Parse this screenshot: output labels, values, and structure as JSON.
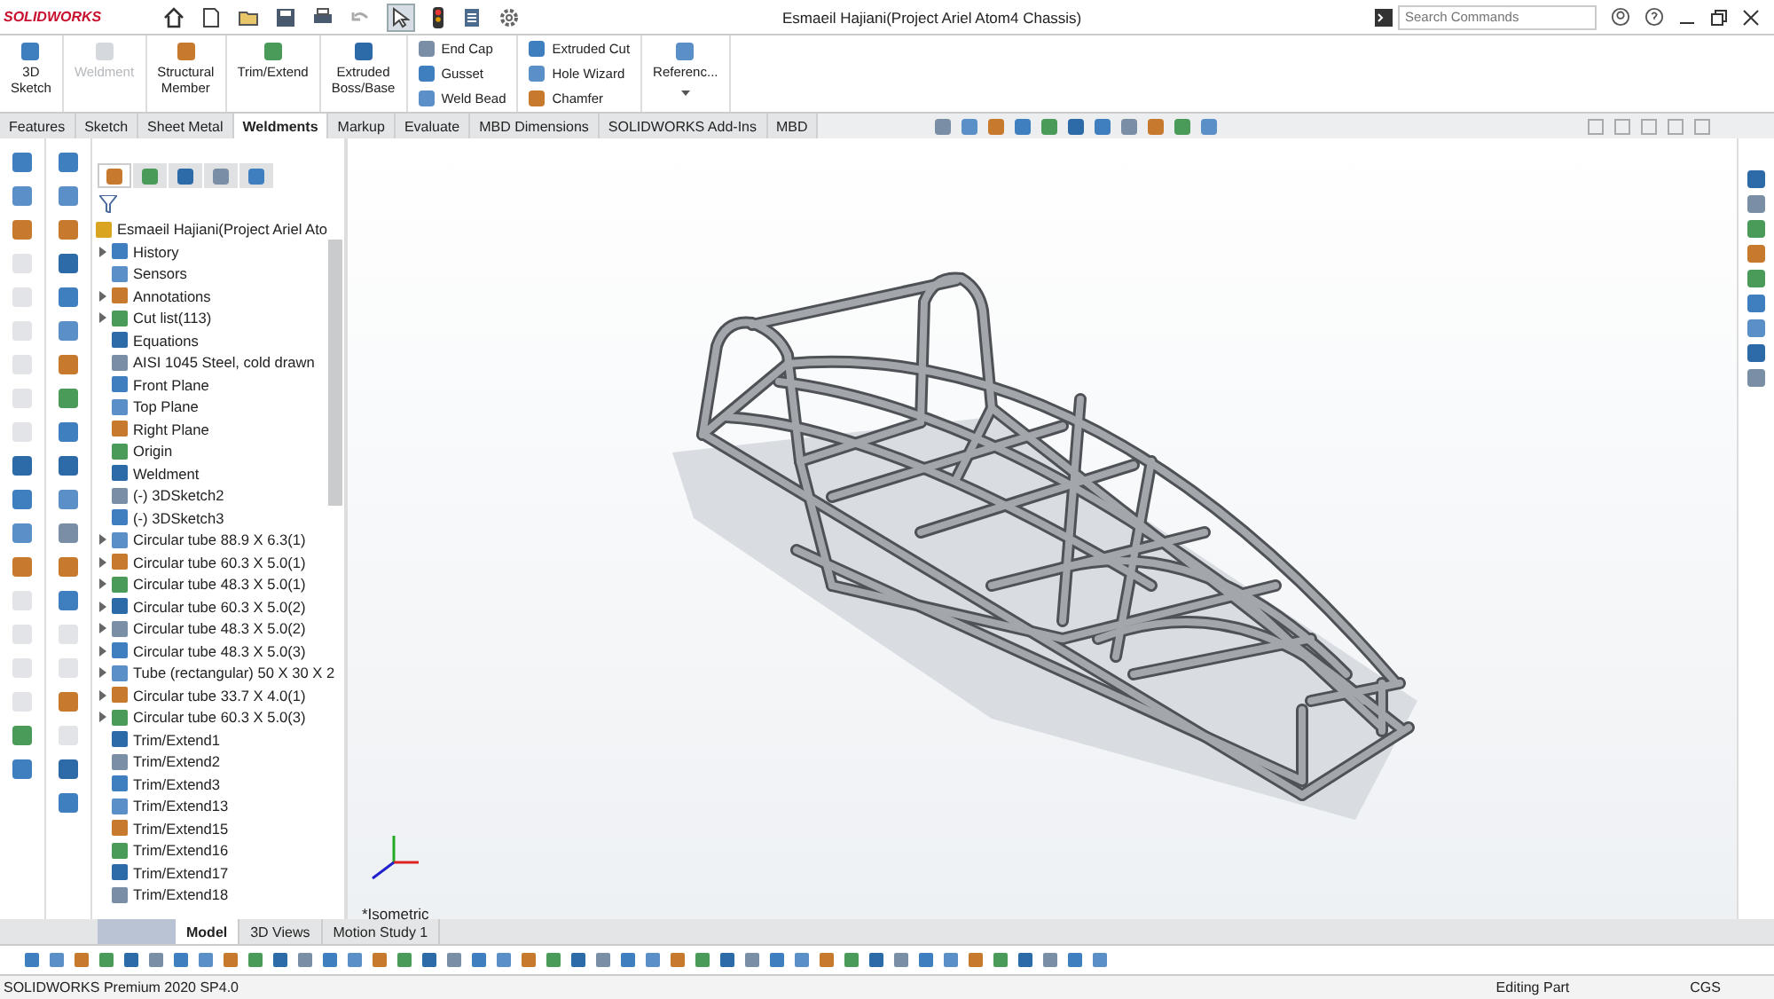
{
  "app": {
    "logo": "SOLIDWORKS"
  },
  "window": {
    "title": "Esmaeil Hajiani(Project Ariel Atom4 Chassis)"
  },
  "search": {
    "placeholder": "Search Commands"
  },
  "ribbon": [
    {
      "kind": "large",
      "items": [
        {
          "lines": [
            "3D",
            "Sketch"
          ],
          "disabled": false
        }
      ]
    },
    {
      "kind": "large",
      "items": [
        {
          "lines": [
            "Weldment"
          ],
          "disabled": true
        }
      ]
    },
    {
      "kind": "large",
      "items": [
        {
          "lines": [
            "Structural",
            "Member"
          ],
          "disabled": false
        }
      ]
    },
    {
      "kind": "large",
      "items": [
        {
          "lines": [
            "Trim/Extend"
          ],
          "disabled": false
        }
      ]
    },
    {
      "kind": "large",
      "items": [
        {
          "lines": [
            "Extruded",
            "Boss/Base"
          ],
          "disabled": false
        }
      ]
    },
    {
      "kind": "stack",
      "items": [
        {
          "lines": [
            "End Cap"
          ],
          "disabled": false
        },
        {
          "lines": [
            "Gusset"
          ],
          "disabled": false
        },
        {
          "lines": [
            "Weld Bead"
          ],
          "disabled": false
        }
      ]
    },
    {
      "kind": "stack",
      "items": [
        {
          "lines": [
            "Extruded Cut"
          ],
          "disabled": false
        },
        {
          "lines": [
            "Hole Wizard"
          ],
          "disabled": false
        },
        {
          "lines": [
            "Chamfer"
          ],
          "disabled": false
        }
      ]
    },
    {
      "kind": "menu",
      "items": [
        {
          "lines": [
            "Referenc..."
          ],
          "disabled": false
        }
      ]
    }
  ],
  "tabs": [
    {
      "label": "Features",
      "selected": false
    },
    {
      "label": "Sketch",
      "selected": false
    },
    {
      "label": "Sheet Metal",
      "selected": false
    },
    {
      "label": "Weldments",
      "selected": true
    },
    {
      "label": "Markup",
      "selected": false
    },
    {
      "label": "Evaluate",
      "selected": false
    },
    {
      "label": "MBD Dimensions",
      "selected": false
    },
    {
      "label": "SOLIDWORKS Add-Ins",
      "selected": false
    },
    {
      "label": "MBD",
      "selected": false
    }
  ],
  "panel_tabs": [
    {
      "selected": true
    },
    {
      "selected": false
    },
    {
      "selected": false
    },
    {
      "selected": false
    },
    {
      "selected": false
    }
  ],
  "tree": {
    "root": "Esmaeil Hajiani(Project Ariel Ato",
    "items": [
      {
        "label": "History",
        "arrow": true
      },
      {
        "label": "Sensors",
        "arrow": false
      },
      {
        "label": "Annotations",
        "arrow": true
      },
      {
        "label": "Cut list(113)",
        "arrow": true
      },
      {
        "label": "Equations",
        "arrow": false
      },
      {
        "label": "AISI 1045 Steel, cold drawn",
        "arrow": false
      },
      {
        "label": "Front Plane",
        "arrow": false
      },
      {
        "label": "Top Plane",
        "arrow": false
      },
      {
        "label": "Right Plane",
        "arrow": false
      },
      {
        "label": "Origin",
        "arrow": false
      },
      {
        "label": "Weldment",
        "arrow": false
      },
      {
        "label": "(-) 3DSketch2",
        "arrow": false
      },
      {
        "label": "(-) 3DSketch3",
        "arrow": false
      },
      {
        "label": "Circular tube 88.9 X 6.3(1)",
        "arrow": true
      },
      {
        "label": "Circular tube 60.3 X 5.0(1)",
        "arrow": true
      },
      {
        "label": "Circular tube 48.3 X 5.0(1)",
        "arrow": true
      },
      {
        "label": "Circular tube 60.3 X 5.0(2)",
        "arrow": true
      },
      {
        "label": "Circular tube 48.3 X 5.0(2)",
        "arrow": true
      },
      {
        "label": "Circular tube 48.3 X 5.0(3)",
        "arrow": true
      },
      {
        "label": "Tube (rectangular) 50 X 30 X 2",
        "arrow": true
      },
      {
        "label": "Circular tube 33.7 X 4.0(1)",
        "arrow": true
      },
      {
        "label": "Circular tube 60.3 X 5.0(3)",
        "arrow": true
      },
      {
        "label": "Trim/Extend1",
        "arrow": false
      },
      {
        "label": "Trim/Extend2",
        "arrow": false
      },
      {
        "label": "Trim/Extend3",
        "arrow": false
      },
      {
        "label": "Trim/Extend13",
        "arrow": false
      },
      {
        "label": "Trim/Extend15",
        "arrow": false
      },
      {
        "label": "Trim/Extend16",
        "arrow": false
      },
      {
        "label": "Trim/Extend17",
        "arrow": false
      },
      {
        "label": "Trim/Extend18",
        "arrow": false
      }
    ]
  },
  "viewport": {
    "view_label": "*Isometric"
  },
  "bottom_tabs": [
    {
      "label": "Model",
      "selected": true
    },
    {
      "label": "3D Views",
      "selected": false
    },
    {
      "label": "Motion Study 1",
      "selected": false
    }
  ],
  "status_bar": {
    "product": "SOLIDWORKS Premium 2020 SP4.0",
    "mode": "Editing Part",
    "units": "CGS"
  }
}
